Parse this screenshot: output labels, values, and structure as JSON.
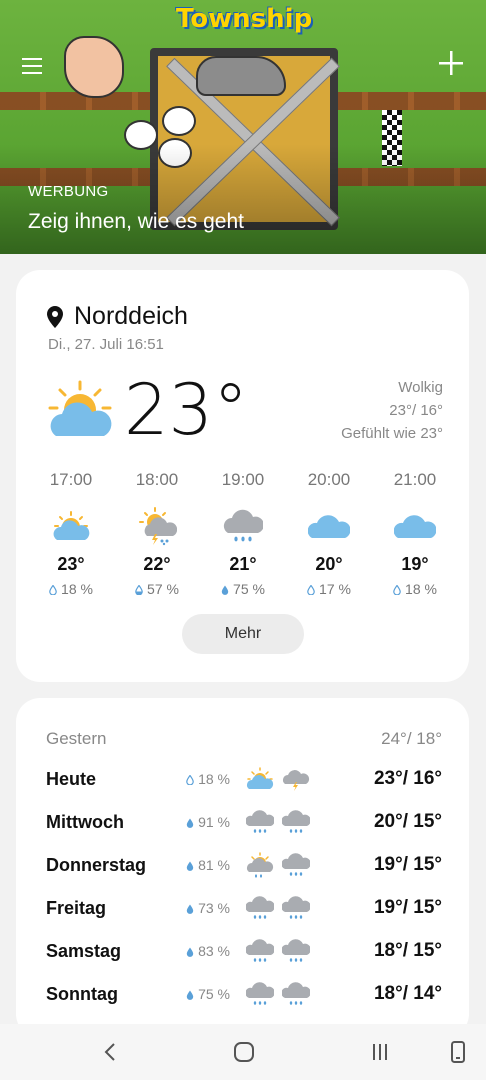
{
  "ad": {
    "game_logo": "Township",
    "label": "WERBUNG",
    "title": "Zeig ihnen, wie es geht",
    "menu_icon": "hamburger-menu-icon",
    "add_icon": "plus-icon"
  },
  "current": {
    "location": "Norddeich",
    "datetime": "Di., 27. Juli 16:51",
    "temp": "23°",
    "icon": "partly-cloudy-icon",
    "condition": "Wolkig",
    "high_low": "23°/ 16°",
    "feels_like": "Gefühlt wie 23°"
  },
  "hourly": [
    {
      "time": "17:00",
      "icon": "partly-cloudy-icon",
      "temp": "23°",
      "precip": "18 %"
    },
    {
      "time": "18:00",
      "icon": "partly-cloudy-thunder-rain-icon",
      "temp": "22°",
      "precip": "57 %"
    },
    {
      "time": "19:00",
      "icon": "rain-icon",
      "temp": "21°",
      "precip": "75 %"
    },
    {
      "time": "20:00",
      "icon": "cloudy-icon",
      "temp": "20°",
      "precip": "17 %"
    },
    {
      "time": "21:00",
      "icon": "cloudy-icon",
      "temp": "19°",
      "precip": "18 %"
    }
  ],
  "more_button": "Mehr",
  "daily": {
    "yesterday": {
      "label": "Gestern",
      "range": "24°/ 18°"
    },
    "days": [
      {
        "day": "Heute",
        "precip": "18 %",
        "icon_day": "partly-cloudy-icon",
        "icon_night": "thunder-cloud-icon",
        "range": "23°/ 16°"
      },
      {
        "day": "Mittwoch",
        "precip": "91 %",
        "icon_day": "rain-icon",
        "icon_night": "rain-icon",
        "range": "20°/ 15°"
      },
      {
        "day": "Donnerstag",
        "precip": "81 %",
        "icon_day": "partly-cloudy-rain-icon",
        "icon_night": "rain-icon",
        "range": "19°/ 15°"
      },
      {
        "day": "Freitag",
        "precip": "73 %",
        "icon_day": "rain-icon",
        "icon_night": "rain-icon",
        "range": "19°/ 15°"
      },
      {
        "day": "Samstag",
        "precip": "83 %",
        "icon_day": "rain-icon",
        "icon_night": "rain-icon",
        "range": "18°/ 15°"
      },
      {
        "day": "Sonntag",
        "precip": "75 %",
        "icon_day": "rain-icon",
        "icon_night": "rain-icon",
        "range": "18°/ 14°"
      }
    ]
  },
  "colors": {
    "sun": "#f7b733",
    "cloud": "#79bde9",
    "rain_cloud": "#a9acb1",
    "drop": "#5aa0d8"
  },
  "navbar": {
    "back_icon": "back-icon",
    "home_icon": "home-icon",
    "recents_icon": "recents-icon",
    "phone_icon": "rotate-phone-icon"
  }
}
